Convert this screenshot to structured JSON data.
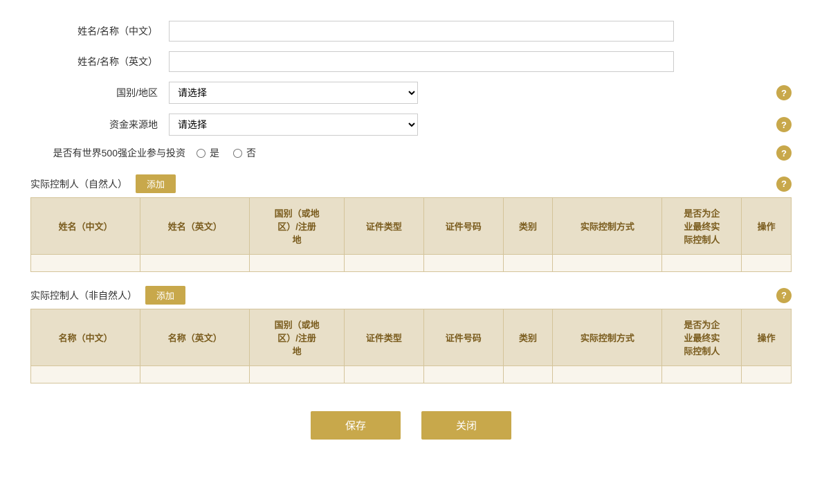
{
  "form": {
    "name_zh_label": "姓名/名称（中文）",
    "name_en_label": "姓名/名称（英文）",
    "country_label": "国别/地区",
    "country_placeholder": "请选择",
    "fund_source_label": "资金来源地",
    "fund_source_placeholder": "请选择",
    "fortune500_label": "是否有世界500强企业参与投资",
    "radio_yes": "是",
    "radio_no": "否"
  },
  "section1": {
    "title": "实际控制人（自然人）",
    "add_label": "添加",
    "columns": [
      "姓名（中文）",
      "姓名（英文）",
      "国别（或地\n区）/注册\n地",
      "证件类型",
      "证件号码",
      "类别",
      "实际控制方式",
      "是否为企\n业最终实\n际控制人",
      "操作"
    ]
  },
  "section2": {
    "title": "实际控制人（非自然人）",
    "add_label": "添加",
    "columns": [
      "名称（中文）",
      "名称（英文）",
      "国别（或地\n区）/注册\n地",
      "证件类型",
      "证件号码",
      "类别",
      "实际控制方式",
      "是否为企\n业最终实\n际控制人",
      "操作"
    ]
  },
  "buttons": {
    "save": "保存",
    "close": "关闭"
  },
  "help_icon": "?"
}
